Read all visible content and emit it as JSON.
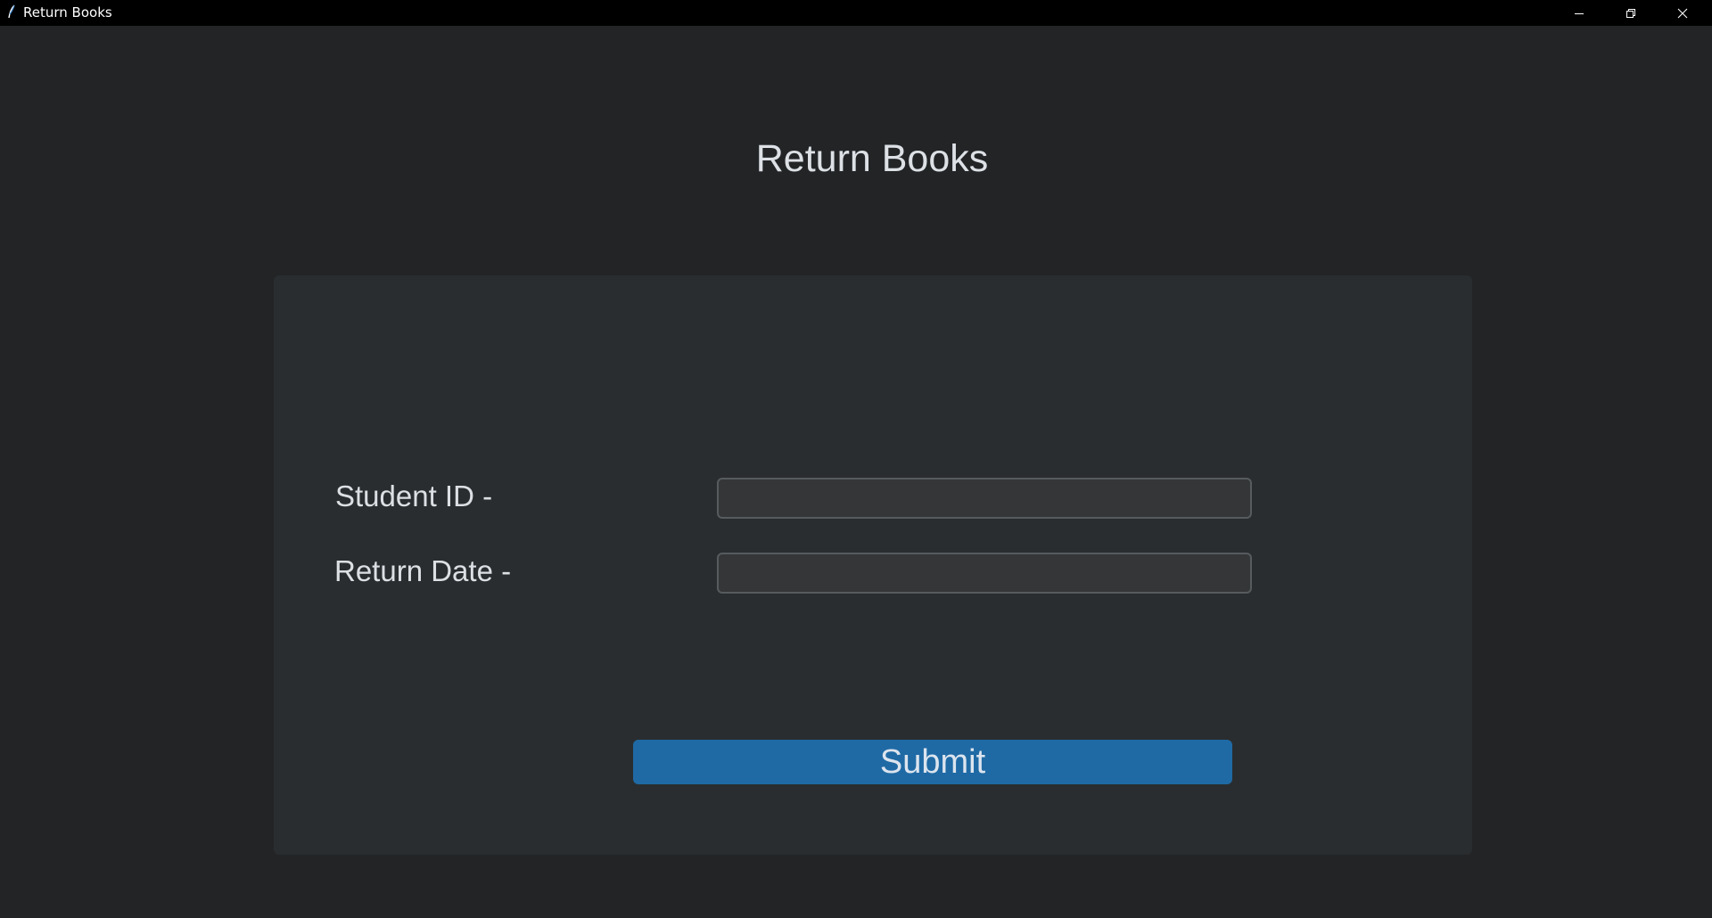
{
  "window": {
    "title": "Return Books",
    "icon": "feather-icon",
    "controls": [
      "minimize-icon",
      "restore-icon",
      "close-icon"
    ]
  },
  "page": {
    "title": "Return Books"
  },
  "form": {
    "student_id_label": "Student ID -",
    "student_id_value": "",
    "return_date_label": "Return Date -",
    "return_date_value": "",
    "submit_label": "Submit"
  },
  "colors": {
    "background": "#222426",
    "panel": "#2a2d2f",
    "field": "#343638",
    "field_border": "#565b5e",
    "accent": "#1f6aa5",
    "titlebar": "#000000"
  }
}
